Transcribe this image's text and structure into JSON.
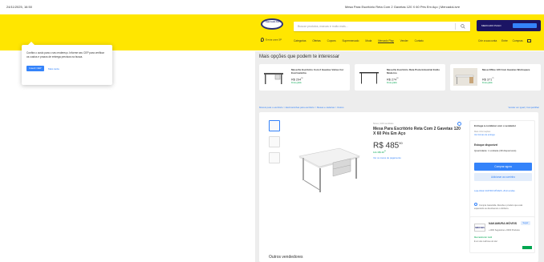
{
  "print_header": {
    "date": "24/11/2025, 16:50",
    "title": "Mesa Para Escritório Reta Com 2 Gavetas 120 X 60 Pés Em Aço | MercadoLivre"
  },
  "header": {
    "logo_text": "mercado livre",
    "search_placeholder": "Buscar produtos, marcas e muito mais…",
    "promo_text": "MERCADO PAGO",
    "cep_label": "Enviar para SP",
    "nav": [
      "Categorias",
      "Ofertas",
      "Cupons",
      "Supermercado",
      "Moda",
      "Mercado Play",
      "Vender",
      "Contato"
    ],
    "account": [
      "Crie a sua conta",
      "Entre",
      "Compras"
    ]
  },
  "popup": {
    "message": "Confira o custo para o seu endereço. Informe seu CEP para verificar os custos e prazos de entrega precisos na busca.",
    "primary_button": "Inserir CEP",
    "secondary_link": "Mais tarde"
  },
  "recommendations": {
    "title": "Mais opções que podem te interessar",
    "items": [
      {
        "name": "Mesa De Escritório Com 2 Gavetas Várias Cor Escrivaninha",
        "price": "R$ 294",
        "cents": "90",
        "note": "Frete grátis"
      },
      {
        "name": "Mesa De Escritório Reta Preta Industrial Estilo Moderno",
        "price": "R$ 274",
        "cents": "90",
        "note": "Frete grátis"
      },
      {
        "name": "Mesa Office 120 Com Gavetas Workspace",
        "price": "R$ 371",
        "cents": "79",
        "note": "Frete grátis"
      }
    ]
  },
  "breadcrumb": "Móveis para o escritório > Escrivaninhas para escritório > Mesas e cadeiras > Outros",
  "sell_link": "Vender um igual | Compartilhar",
  "product": {
    "condition": "Novo | 100 vendidos",
    "title": "Mesa Para Escritório Reta Com 2 Gavetas 120 X 60 Pés Em Aço",
    "price": "R$ 485",
    "cents": "90",
    "installments": "12x R$ 40",
    "installments_cents": "49",
    "payment_link": "Ver os meios de pagamento"
  },
  "buybox": {
    "shipping": "Entrega à combinar com o vendedor",
    "shipping_sub": "Mais informações",
    "shipping_link": "Ver formas de entrega",
    "stock": "Estoque disponível",
    "qty": "Quantidade: 1 unidade (39 disponíveis)",
    "buy_button": "Comprar agora",
    "cart_button": "Adicionar ao carrinho",
    "seller": "Loja oficial CASTRO MÓVEIS +5mil vendas",
    "protection": "Compra Garantida. Receba o produto que está esperando ou devolvemos o dinheiro."
  },
  "description_title": "Outros vendedores",
  "store": {
    "logo_text": "NMOVEIS",
    "name": "NAKAMURA MÓVEIS",
    "desc": "+1000 Seguidores  +5000 Produtos",
    "follow": "Seguir",
    "lider": "MercadoLíder Gold",
    "lider_sub": "É um dos melhores do site!"
  }
}
